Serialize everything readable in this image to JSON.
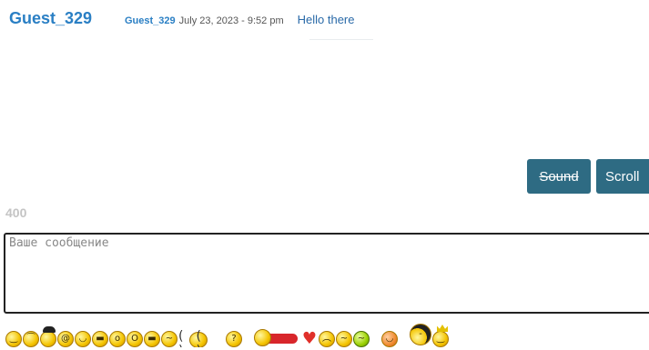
{
  "header": {
    "user": "Guest_329"
  },
  "messages": [
    {
      "author": "Guest_329",
      "time": "July 23, 2023 - 9:52 pm",
      "text": "Hello there"
    }
  ],
  "buttons": {
    "sound": "Sound",
    "scroll": "Scroll"
  },
  "composer": {
    "counter": "400",
    "placeholder": "Ваше сообщение",
    "value": ""
  },
  "smileys": [
    "smile-icon",
    "wink-icon",
    "pirate-icon",
    "dizzy-icon",
    "laugh-icon",
    "grin-icon",
    "surprised-icon",
    "shocked-icon",
    "cool-icon",
    "confused-icon",
    "spider-icon",
    "think-icon",
    "superman-icon",
    "heart-icon",
    "sad-icon",
    "sick-icon",
    "green-icon",
    "blush-icon",
    "mobster-icon",
    "king-icon"
  ]
}
